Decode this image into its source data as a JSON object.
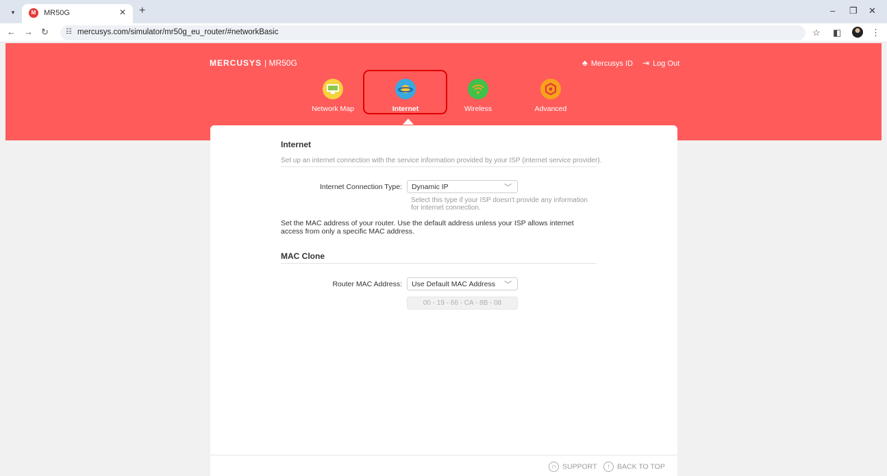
{
  "browser": {
    "tab_title": "MR50G",
    "tab_favicon_letter": "M",
    "url": "mercusys.com/simulator/mr50g_eu_router/#networkBasic"
  },
  "header": {
    "brand": "MERCUSYS",
    "model": "| MR50G",
    "mercusys_id": "Mercusys ID",
    "logout": "Log Out",
    "nav": [
      {
        "label": "Network Map",
        "icon": "network-map-icon",
        "color": "#f6d23e"
      },
      {
        "label": "Internet",
        "icon": "globe-icon",
        "color": "#39a9e0",
        "active": true
      },
      {
        "label": "Wireless",
        "icon": "wifi-icon",
        "color": "#3fc14a"
      },
      {
        "label": "Advanced",
        "icon": "gear-icon",
        "color": "#f7a21b"
      }
    ]
  },
  "internet": {
    "title": "Internet",
    "description": "Set up an internet connection with the service information provided by your ISP (internet service provider).",
    "connection_type_label": "Internet Connection Type:",
    "connection_type_value": "Dynamic IP",
    "connection_type_hint": "Select this type if your ISP doesn't provide any information for internet connection.",
    "mac_note": "Set the MAC address of your router. Use the default address unless your ISP allows internet access from only a specific MAC address."
  },
  "mac_clone": {
    "title": "MAC Clone",
    "router_mac_label": "Router MAC Address:",
    "router_mac_value": "Use Default MAC Address",
    "mac_address": "00 - 19 - 66 - CA - 8B - 08"
  },
  "footer": {
    "support": "SUPPORT",
    "back_to_top": "BACK TO TOP"
  }
}
